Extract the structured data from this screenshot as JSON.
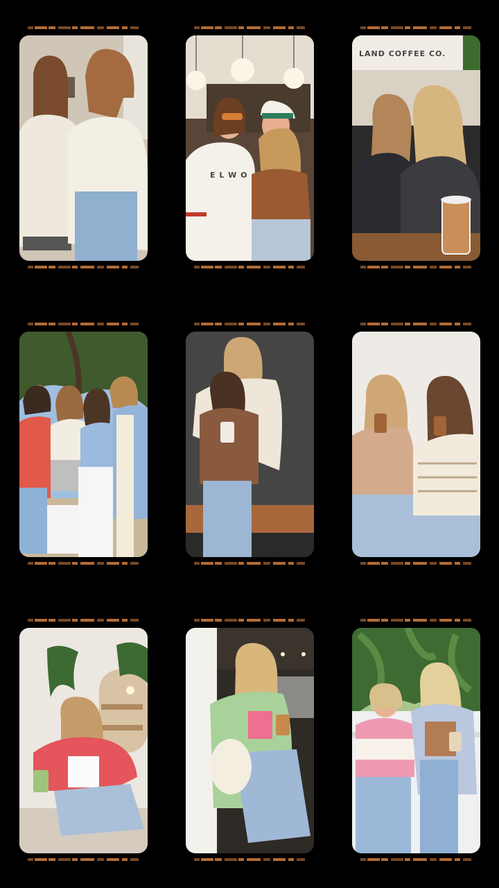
{
  "grid": {
    "photos": [
      {
        "id": "photo-1",
        "subject": "two-friends-sweaters"
      },
      {
        "id": "photo-2",
        "subject": "friends-in-bar"
      },
      {
        "id": "photo-3",
        "subject": "friends-coffee-shop",
        "sign_text": "LAND COFFEE CO."
      },
      {
        "id": "photo-4",
        "subject": "four-friends-outdoors"
      },
      {
        "id": "photo-5",
        "subject": "friends-hugging-coffee"
      },
      {
        "id": "photo-6",
        "subject": "friends-sipping-drinks"
      },
      {
        "id": "photo-7",
        "subject": "girl-pink-jacket-cafe"
      },
      {
        "id": "photo-8",
        "subject": "girl-green-cardigan"
      },
      {
        "id": "photo-9",
        "subject": "friends-palm-trees"
      }
    ]
  },
  "colors": {
    "background": "#000000",
    "film_marks": "#c8783a"
  }
}
